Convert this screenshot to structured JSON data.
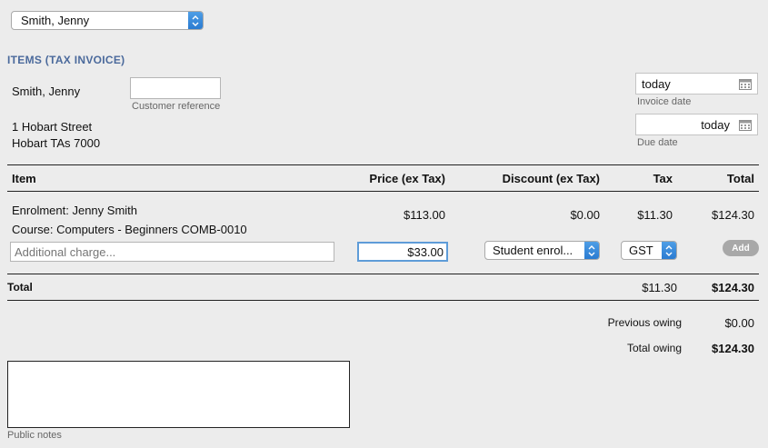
{
  "customer_select": {
    "value": "Smith, Jenny"
  },
  "section_title": "ITEMS (TAX INVOICE)",
  "customer": {
    "name": "Smith, Jenny",
    "address_line1": "1 Hobart Street",
    "address_line2": "Hobart TAs 7000"
  },
  "customer_reference": {
    "value": "",
    "label": "Customer reference"
  },
  "invoice_date": {
    "value": "today",
    "label": "Invoice date"
  },
  "due_date": {
    "value": "today",
    "label": "Due date"
  },
  "table": {
    "headers": {
      "item": "Item",
      "price": "Price (ex Tax)",
      "discount": "Discount (ex Tax)",
      "tax": "Tax",
      "total": "Total"
    },
    "row": {
      "line1": "Enrolment: Jenny Smith",
      "line2": "Course: Computers - Beginners COMB-0010",
      "price": "$113.00",
      "discount": "$0.00",
      "tax": "$11.30",
      "total": "$124.30"
    },
    "new_line": {
      "description_placeholder": "Additional charge...",
      "price_value": "$33.00",
      "discount_select": "Student enrol...",
      "tax_select": "GST",
      "add_label": "Add"
    },
    "totals": {
      "label": "Total",
      "tax": "$11.30",
      "total": "$124.30"
    }
  },
  "summary": {
    "previous_owing_label": "Previous owing",
    "previous_owing_value": "$0.00",
    "total_owing_label": "Total owing",
    "total_owing_value": "$124.30"
  },
  "public_notes": {
    "value": "",
    "label": "Public notes"
  },
  "colors": {
    "accent": "#4b6a9c",
    "select_arrow": "#2a7bd1",
    "focus": "#5e9cd8"
  }
}
